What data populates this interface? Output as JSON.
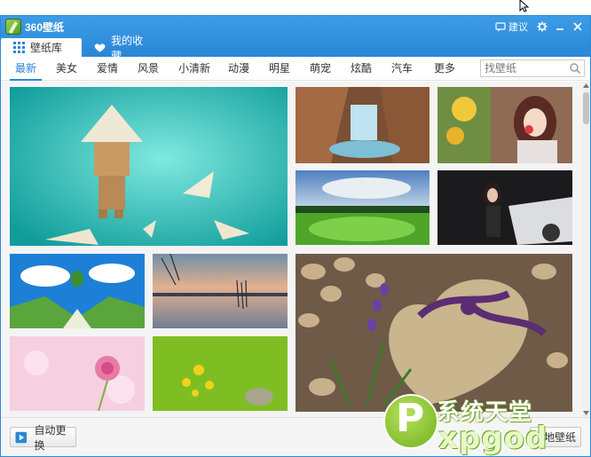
{
  "app": {
    "title": "360壁纸",
    "feedback_label": "建议"
  },
  "tabs": [
    {
      "label": "壁纸库"
    },
    {
      "label": "我的收藏"
    }
  ],
  "categories": [
    "最新",
    "美女",
    "爱情",
    "风景",
    "小清新",
    "动漫",
    "明星",
    "萌宠",
    "炫酷",
    "汽车",
    "更多"
  ],
  "active_category": "最新",
  "search": {
    "placeholder": "找壁纸"
  },
  "wallpapers": [
    {
      "label": "danbo-paper-boats"
    },
    {
      "label": "canyon-waterfall"
    },
    {
      "label": "anime-girl-flowers"
    },
    {
      "label": "green-field-sky"
    },
    {
      "label": "car-model"
    },
    {
      "label": "hot-air-balloon"
    },
    {
      "label": "lake-sunset"
    },
    {
      "label": "heart-stone-ribbon"
    },
    {
      "label": "pink-rose"
    },
    {
      "label": "yellow-flowers-green"
    }
  ],
  "footer": {
    "auto_change_label": "自动更换",
    "set_wallpaper_label": "地壁纸"
  },
  "watermark": {
    "top_text": "系统天堂",
    "bottom_text": "xpgod",
    "logo_letter": "P"
  },
  "colors": {
    "accent": "#2a86d6",
    "titlebar": "#3d9ce6"
  }
}
